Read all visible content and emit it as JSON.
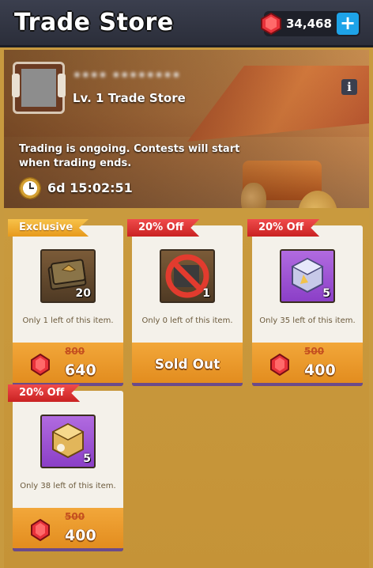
{
  "header": {
    "title": "Trade Store",
    "currency_amount": "34,468",
    "plus_label": "+"
  },
  "banner": {
    "player_name": "•••• ••••••••",
    "store_level": "Lv. 1 Trade Store",
    "status": "Trading is ongoing. Contests will start when trading ends.",
    "timer": "6d 15:02:51",
    "info_label": "i"
  },
  "items": [
    {
      "tag": "Exclusive",
      "count": "20",
      "stock": "Only 1 left of this item.",
      "old_price": "800",
      "price": "640",
      "sold_out": false
    },
    {
      "tag": "20% Off",
      "count": "1",
      "stock": "Only 0 left of this item.",
      "old_price": "",
      "price": "",
      "sold_out": true,
      "sold_out_label": "Sold Out"
    },
    {
      "tag": "20% Off",
      "count": "5",
      "stock": "Only 35 left of this item.",
      "old_price": "500",
      "price": "400",
      "sold_out": false
    },
    {
      "tag": "20% Off",
      "count": "5",
      "stock": "Only 38 left of this item.",
      "old_price": "500",
      "price": "400",
      "sold_out": false
    }
  ],
  "colors": {
    "gem": "#e8323a",
    "accent_blue": "#1ea3e8",
    "tag_red": "#e03a3a",
    "tag_gold": "#f0aa2c"
  }
}
